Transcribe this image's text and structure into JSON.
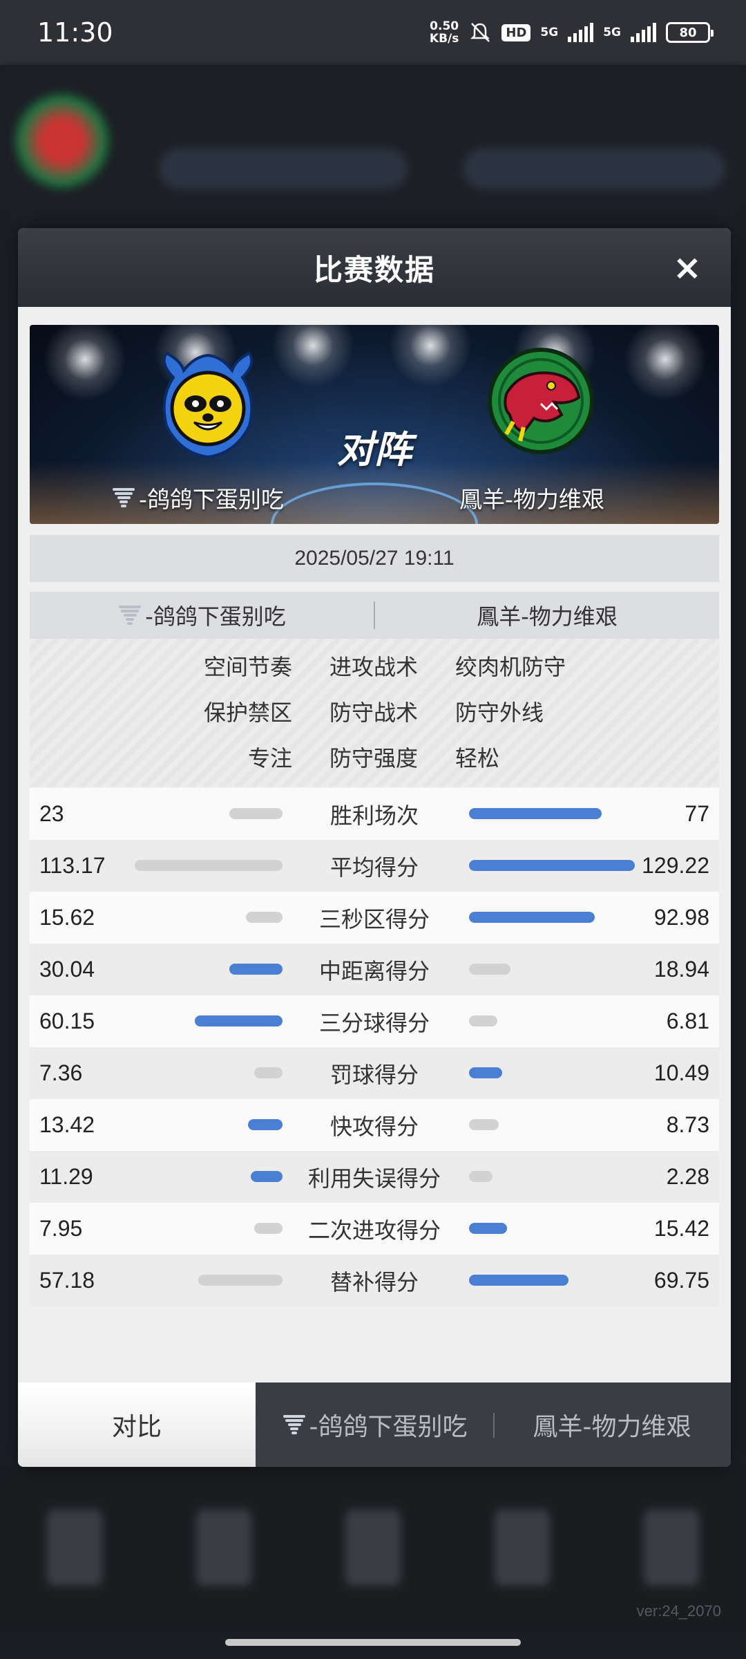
{
  "status": {
    "time": "11:30",
    "net_speed_value": "0.50",
    "net_speed_unit": "KB/s",
    "hd_label": "HD",
    "net1": "5G",
    "net2": "5G",
    "battery": "80"
  },
  "modal": {
    "title": "比赛数据",
    "close_icon": "×"
  },
  "banner": {
    "vs_label": "对阵",
    "left_team": "-鸽鸽下蛋别吃",
    "right_team": "鳳羊-物力维艰"
  },
  "date": "2025/05/27 19:11",
  "teams": {
    "left": "-鸽鸽下蛋别吃",
    "right": "鳳羊-物力维艰"
  },
  "tactics": [
    {
      "left": "空间节奏",
      "label": "进攻战术",
      "right": "绞肉机防守"
    },
    {
      "left": "保护禁区",
      "label": "防守战术",
      "right": "防守外线"
    },
    {
      "left": "专注",
      "label": "防守强度",
      "right": "轻松"
    }
  ],
  "stats": [
    {
      "label": "胜利场次",
      "left": "23",
      "right": "77",
      "left_bar": 0.32,
      "right_bar": 0.8,
      "left_color": "#d2d2d2",
      "right_color": "#4a7fd4"
    },
    {
      "label": "平均得分",
      "left": "113.17",
      "right": "129.22",
      "left_bar": 0.89,
      "right_bar": 1.0,
      "left_color": "#d2d2d2",
      "right_color": "#4a7fd4"
    },
    {
      "label": "三秒区得分",
      "left": "15.62",
      "right": "92.98",
      "left_bar": 0.22,
      "right_bar": 0.76,
      "left_color": "#d2d2d2",
      "right_color": "#4a7fd4"
    },
    {
      "label": "中距离得分",
      "left": "30.04",
      "right": "18.94",
      "left_bar": 0.32,
      "right_bar": 0.25,
      "left_color": "#4a7fd4",
      "right_color": "#d2d2d2"
    },
    {
      "label": "三分球得分",
      "left": "60.15",
      "right": "6.81",
      "left_bar": 0.53,
      "right_bar": 0.17,
      "left_color": "#4a7fd4",
      "right_color": "#d2d2d2"
    },
    {
      "label": "罚球得分",
      "left": "7.36",
      "right": "10.49",
      "left_bar": 0.17,
      "right_bar": 0.2,
      "left_color": "#d2d2d2",
      "right_color": "#4a7fd4"
    },
    {
      "label": "快攻得分",
      "left": "13.42",
      "right": "8.73",
      "left_bar": 0.21,
      "right_bar": 0.18,
      "left_color": "#4a7fd4",
      "right_color": "#d2d2d2"
    },
    {
      "label": "利用失误得分",
      "left": "11.29",
      "right": "2.28",
      "left_bar": 0.19,
      "right_bar": 0.14,
      "left_color": "#4a7fd4",
      "right_color": "#d2d2d2"
    },
    {
      "label": "二次进攻得分",
      "left": "7.95",
      "right": "15.42",
      "left_bar": 0.17,
      "right_bar": 0.23,
      "left_color": "#d2d2d2",
      "right_color": "#4a7fd4"
    },
    {
      "label": "替补得分",
      "left": "57.18",
      "right": "69.75",
      "left_bar": 0.51,
      "right_bar": 0.6,
      "left_color": "#d2d2d2",
      "right_color": "#4a7fd4"
    }
  ],
  "tabs": {
    "compare": "对比",
    "left_team": "-鸽鸽下蛋别吃",
    "right_team": "鳳羊-物力维艰"
  },
  "version": "ver:24_2070"
}
